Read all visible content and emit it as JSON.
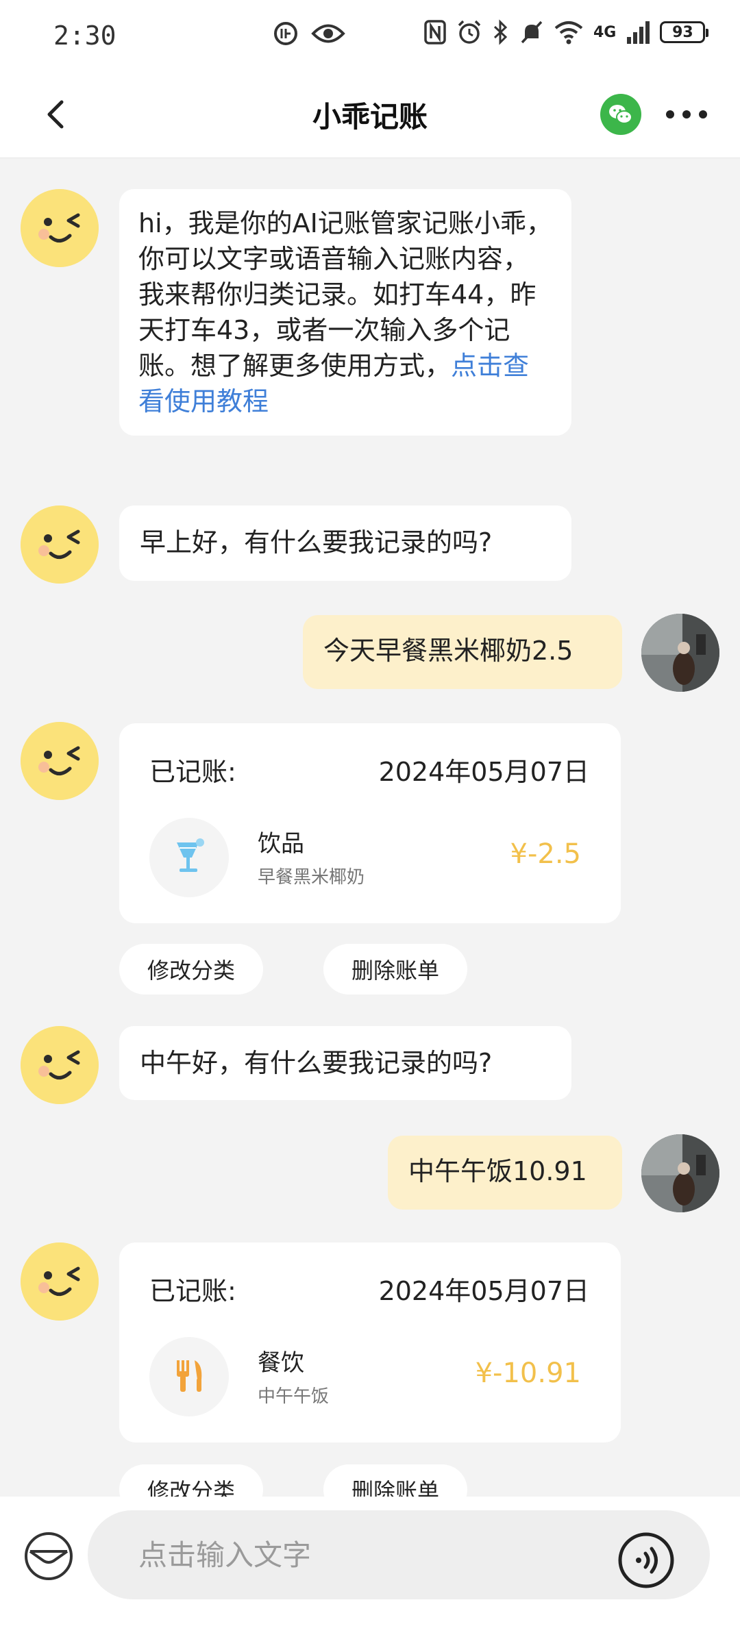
{
  "status_bar": {
    "time": "2:30",
    "network": "4G",
    "battery": "93"
  },
  "header": {
    "title": "小乖记账"
  },
  "messages": {
    "welcome_text": "hi，我是你的AI记账管家记账小乖，你可以文字或语音输入记账内容，我来帮你归类记录。如打车44，昨天打车43，或者一次输入多个记账。想了解更多使用方式，",
    "welcome_link": "点击查看使用教程",
    "greeting_morning": "早上好，有什么要我记录的吗?",
    "user_msg_1": "今天早餐黑米椰奶2.5",
    "greeting_noon": "中午好，有什么要我记录的吗?",
    "user_msg_2": "中午午饭10.91"
  },
  "records": [
    {
      "label": "已记账:",
      "date": "2024年05月07日",
      "category": "饮品",
      "category_icon": "drink-icon",
      "note": "早餐黑米椰奶",
      "amount": "¥-2.5",
      "edit_label": "修改分类",
      "delete_label": "删除账单"
    },
    {
      "label": "已记账:",
      "date": "2024年05月07日",
      "category": "餐饮",
      "category_icon": "dining-icon",
      "note": "中午午饭",
      "amount": "¥-10.91",
      "edit_label": "修改分类",
      "delete_label": "删除账单"
    }
  ],
  "input": {
    "placeholder": "点击输入文字"
  },
  "colors": {
    "user_bubble": "#fdf0cb",
    "amount": "#f2c04b",
    "link": "#3f7fd8",
    "wechat": "#3cb64a"
  }
}
